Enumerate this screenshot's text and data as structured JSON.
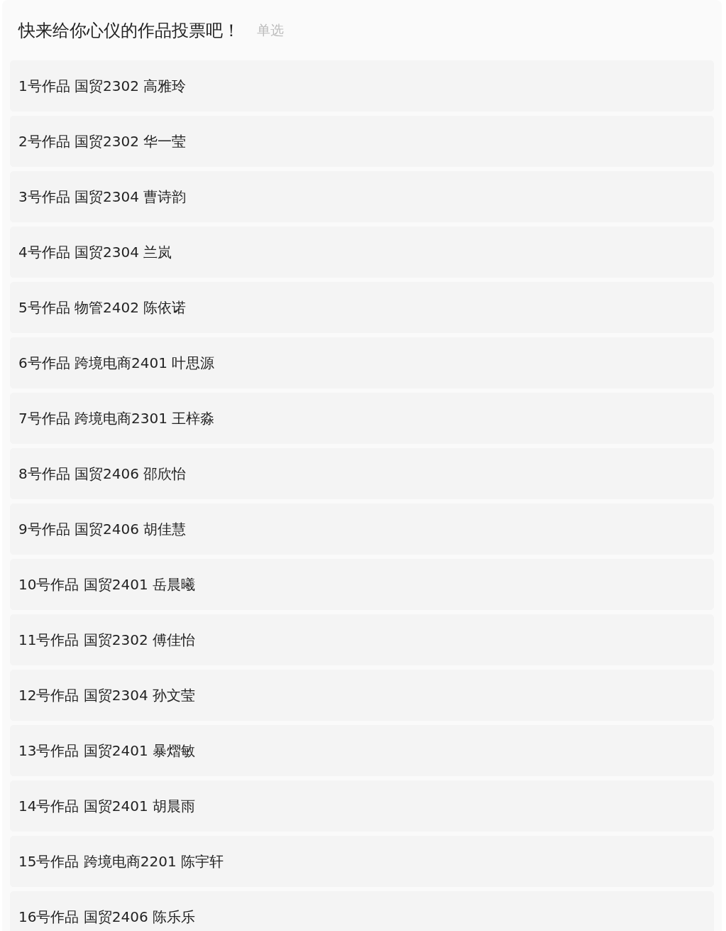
{
  "question": {
    "title": "快来给你心仪的作品投票吧！",
    "type_label": "单选"
  },
  "options": [
    {
      "label": "1号作品 国贸2302 高雅玲",
      "selected": false
    },
    {
      "label": "2号作品 国贸2302 华一莹",
      "selected": false
    },
    {
      "label": "3号作品 国贸2304 曹诗韵",
      "selected": false
    },
    {
      "label": "4号作品 国贸2304 兰岚",
      "selected": false
    },
    {
      "label": "5号作品 物管2402 陈依诺",
      "selected": false
    },
    {
      "label": "6号作品 跨境电商2401 叶思源",
      "selected": false
    },
    {
      "label": "7号作品 跨境电商2301 王梓淼",
      "selected": false
    },
    {
      "label": "8号作品 国贸2406 邵欣怡",
      "selected": false
    },
    {
      "label": "9号作品 国贸2406 胡佳慧",
      "selected": false
    },
    {
      "label": "10号作品 国贸2401 岳晨曦",
      "selected": false
    },
    {
      "label": "11号作品 国贸2302 傅佳怡",
      "selected": false
    },
    {
      "label": "12号作品 国贸2304 孙文莹",
      "selected": false
    },
    {
      "label": "13号作品 国贸2401 暴熠敏",
      "selected": false
    },
    {
      "label": "14号作品 国贸2401 胡晨雨",
      "selected": false
    },
    {
      "label": "15号作品 跨境电商2201 陈宇轩",
      "selected": false
    },
    {
      "label": "16号作品 国贸2406 陈乐乐",
      "selected": false
    }
  ]
}
